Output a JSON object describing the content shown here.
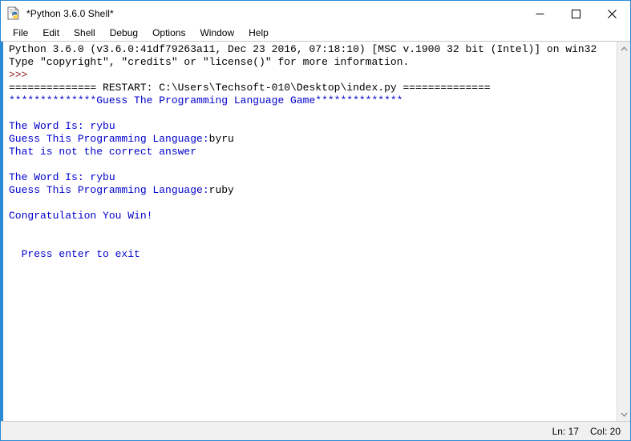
{
  "window": {
    "title": "*Python 3.6.0 Shell*",
    "icon": "python-document-icon",
    "controls": {
      "minimize_label": "Minimize",
      "maximize_label": "Maximize",
      "close_label": "Close"
    }
  },
  "menubar": {
    "items": [
      {
        "label": "File"
      },
      {
        "label": "Edit"
      },
      {
        "label": "Shell"
      },
      {
        "label": "Debug"
      },
      {
        "label": "Options"
      },
      {
        "label": "Window"
      },
      {
        "label": "Help"
      }
    ]
  },
  "shell": {
    "lines": [
      {
        "id": "l01",
        "text": "Python 3.6.0 (v3.6.0:41df79263a11, Dec 23 2016, 07:18:10) [MSC v.1900 32 bit (Intel)] on win32",
        "color": "black"
      },
      {
        "id": "l02",
        "text": "Type \"copyright\", \"credits\" or \"license()\" for more information.",
        "color": "black"
      },
      {
        "id": "l03",
        "text": ">>>",
        "color": "prompt"
      },
      {
        "id": "l04",
        "text": "============== RESTART: C:\\Users\\Techsoft-010\\Desktop\\index.py ==============",
        "color": "black"
      },
      {
        "id": "l05",
        "text": "**************Guess The Programming Language Game**************",
        "color": "blue"
      },
      {
        "id": "l06",
        "text": "",
        "color": "blue"
      },
      {
        "id": "l07",
        "text": "The Word Is: rybu",
        "color": "blue"
      },
      {
        "id": "l08",
        "prompt": "Guess This Programming Language:",
        "input": "byru",
        "color": "blue",
        "input_color": "black"
      },
      {
        "id": "l09",
        "text": "That is not the correct answer",
        "color": "blue"
      },
      {
        "id": "l10",
        "text": "",
        "color": "blue"
      },
      {
        "id": "l11",
        "text": "The Word Is: rybu",
        "color": "blue"
      },
      {
        "id": "l12",
        "prompt": "Guess This Programming Language:",
        "input": "ruby",
        "color": "blue",
        "input_color": "black"
      },
      {
        "id": "l13",
        "text": "",
        "color": "blue"
      },
      {
        "id": "l14",
        "text": "Congratulation You Win!",
        "color": "blue"
      },
      {
        "id": "l15",
        "text": "",
        "color": "blue"
      },
      {
        "id": "l16",
        "text": "",
        "color": "blue"
      },
      {
        "id": "l17",
        "text": "  Press enter to exit",
        "color": "blue"
      }
    ]
  },
  "scrollbar": {
    "up_arrow": "chevron-up-icon",
    "down_arrow": "chevron-down-icon"
  },
  "statusbar": {
    "line": "Ln: 17",
    "column": "Col: 20"
  },
  "colors": {
    "accent_border": "#2a8ad4",
    "shell_blue": "#0000cc",
    "shell_prompt": "#8b1a1a",
    "shell_black": "#000000",
    "chrome": "#f0f0f0"
  }
}
